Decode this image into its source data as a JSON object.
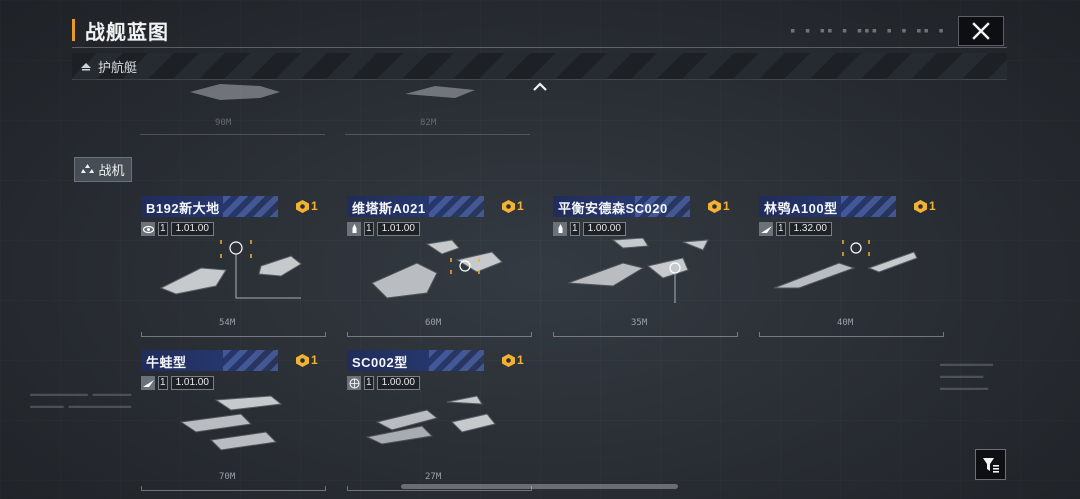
{
  "header": {
    "title": "战舰蓝图"
  },
  "section_escort": {
    "label": "护航艇"
  },
  "ghost_row": {
    "lengths": [
      "90M",
      "82M"
    ]
  },
  "category_chip": {
    "label": "战机"
  },
  "cards": [
    {
      "name": "B192新大地",
      "cost": "1",
      "stat_icon": "eye-icon",
      "count": "1",
      "version": "1.01.00",
      "length": "54M"
    },
    {
      "name": "维塔斯A021",
      "cost": "1",
      "stat_icon": "rocket-icon",
      "count": "1",
      "version": "1.01.00",
      "length": "60M"
    },
    {
      "name": "平衡安德森SC020",
      "cost": "1",
      "stat_icon": "rocket-icon",
      "count": "1",
      "version": "1.00.00",
      "length": "35M"
    },
    {
      "name": "林鸮A100型",
      "cost": "1",
      "stat_icon": "wing-icon",
      "count": "1",
      "version": "1.32.00",
      "length": "40M"
    },
    {
      "name": "牛蛙型",
      "cost": "1",
      "stat_icon": "wing-icon",
      "count": "1",
      "version": "1.01.00",
      "length": "70M"
    },
    {
      "name": "SC002型",
      "cost": "1",
      "stat_icon": "globe-icon",
      "count": "1",
      "version": "1.00.00",
      "length": "27M"
    }
  ],
  "colors": {
    "accent": "#e89a2a",
    "cost": "#f2b233",
    "header_blue": "#26376e"
  }
}
